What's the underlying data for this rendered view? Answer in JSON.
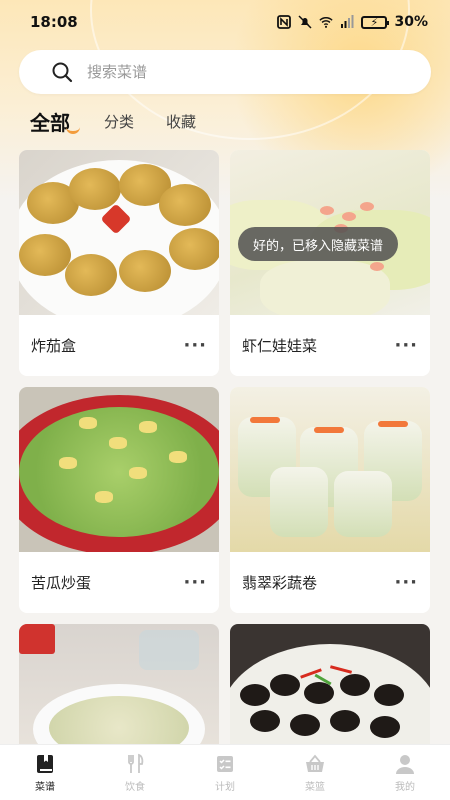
{
  "status_bar": {
    "time": "18:08",
    "battery": "30%"
  },
  "search": {
    "placeholder": "搜索菜谱"
  },
  "tabs": [
    {
      "label": "全部",
      "active": true
    },
    {
      "label": "分类",
      "active": false
    },
    {
      "label": "收藏",
      "active": false
    }
  ],
  "recipes": [
    {
      "title": "炸茄盒"
    },
    {
      "title": "虾仁娃娃菜"
    },
    {
      "title": "苦瓜炒蛋"
    },
    {
      "title": "翡翠彩蔬卷"
    },
    {
      "title": ""
    },
    {
      "title": ""
    }
  ],
  "card_more_label": "···",
  "toast": {
    "message": "好的，已移入隐藏菜谱"
  },
  "bottom_nav": [
    {
      "label": "菜谱",
      "icon": "book-icon",
      "active": true
    },
    {
      "label": "饮食",
      "icon": "cutlery-icon",
      "active": false
    },
    {
      "label": "计划",
      "icon": "checklist-icon",
      "active": false
    },
    {
      "label": "菜篮",
      "icon": "basket-icon",
      "active": false
    },
    {
      "label": "我的",
      "icon": "user-icon",
      "active": false
    }
  ],
  "colors": {
    "accent": "#f39c3c",
    "background": "#f5f3f0"
  }
}
